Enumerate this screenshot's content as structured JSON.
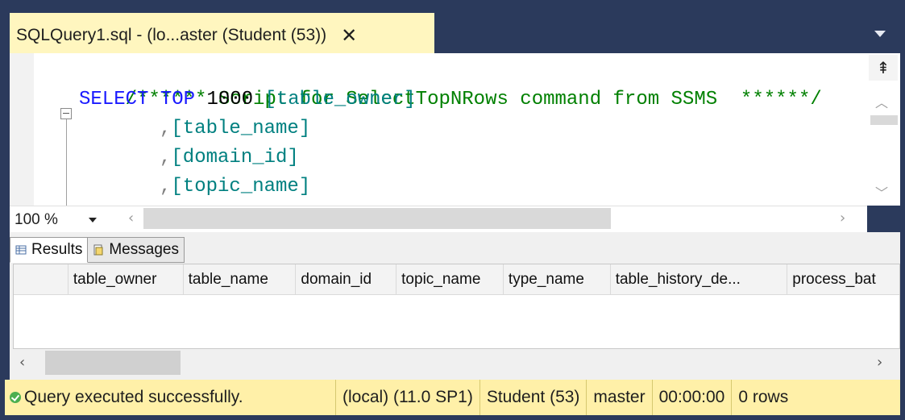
{
  "document_tab": {
    "label": "SQLQuery1.sql - (lo...aster (Student (53))",
    "close_glyph": "✕"
  },
  "editor": {
    "lines": [
      {
        "comment": "/****** Script for SelectTopNRows command from SSMS  ******/"
      },
      {
        "kw1": "SELECT",
        "kw2": "TOP",
        "num": "1000",
        "ident": "[table_owner]"
      },
      {
        "punct": ",",
        "ident": "[table_name]"
      },
      {
        "punct": ",",
        "ident": "[domain_id]"
      },
      {
        "punct": ",",
        "ident": "[topic_name]"
      }
    ]
  },
  "zoom": {
    "value": "100 %"
  },
  "results_tabs": [
    {
      "label": "Results",
      "icon": "grid-icon"
    },
    {
      "label": "Messages",
      "icon": "messages-icon"
    }
  ],
  "grid": {
    "columns": [
      "table_owner",
      "table_name",
      "domain_id",
      "topic_name",
      "type_name",
      "table_history_de...",
      "process_bat"
    ]
  },
  "status": {
    "message": "Query executed successfully.",
    "server": "(local) (11.0 SP1)",
    "user": "Student (53)",
    "database": "master",
    "elapsed": "00:00:00",
    "rows": "0 rows"
  },
  "colors": {
    "frame": "#2b3a5c",
    "tab_active": "#fff6bf",
    "status_bar": "#fff0a8",
    "keyword": "#1a1aff",
    "comment": "#008000",
    "identifier": "#008080"
  }
}
